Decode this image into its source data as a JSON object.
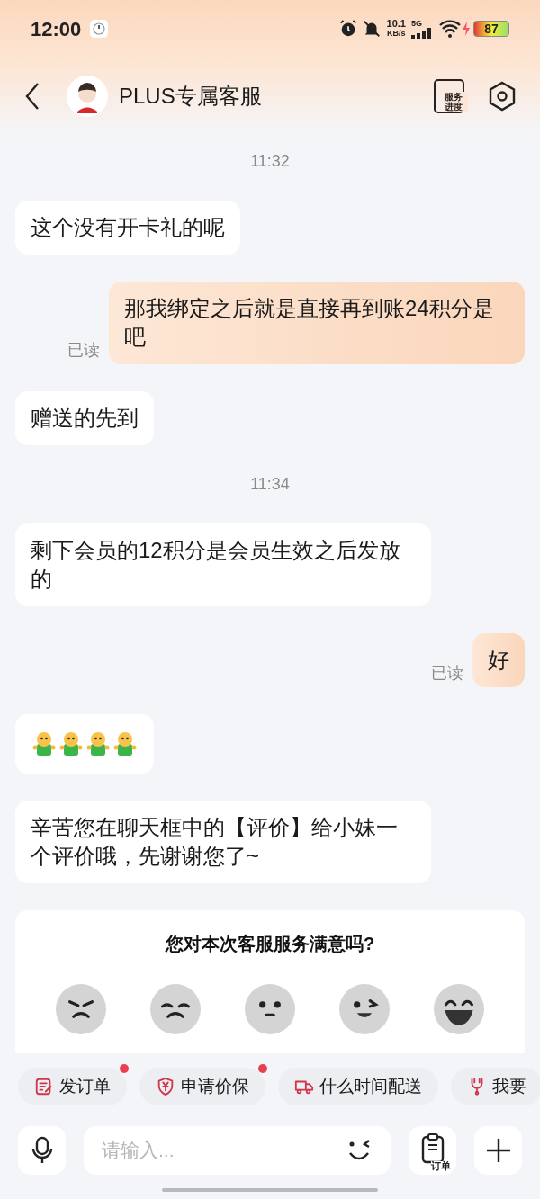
{
  "status_bar": {
    "time": "12:00",
    "net_speed": "10.1",
    "net_unit": "KB/s",
    "network": "5G",
    "battery": "87"
  },
  "header": {
    "title": "PLUS专属客服",
    "progress_label": "服务进度"
  },
  "messages": [
    {
      "kind": "time",
      "text": "11:32"
    },
    {
      "kind": "incoming",
      "text": "这个没有开卡礼的呢"
    },
    {
      "kind": "outgoing",
      "text": "那我绑定之后就是直接再到账24积分是吧",
      "status": "已读"
    },
    {
      "kind": "incoming",
      "text": "赠送的先到"
    },
    {
      "kind": "time",
      "text": "11:34"
    },
    {
      "kind": "incoming",
      "text": "剩下会员的12积分是会员生效之后发放的"
    },
    {
      "kind": "outgoing",
      "text": "好",
      "status": "已读"
    },
    {
      "kind": "stickers",
      "items": [
        {
          "kind": "figure"
        },
        {
          "kind": "figure"
        },
        {
          "kind": "figure"
        },
        {
          "kind": "figure"
        }
      ]
    },
    {
      "kind": "incoming",
      "text": "辛苦您在聊天框中的【评价】给小妹一个评价哦，先谢谢您了~"
    },
    {
      "kind": "rating",
      "question": "您对本次客服服务满意吗?",
      "faces": [
        {
          "kind": "angry"
        },
        {
          "kind": "sad"
        },
        {
          "kind": "neutral"
        },
        {
          "kind": "wink"
        },
        {
          "kind": "laugh"
        }
      ]
    }
  ],
  "quick_actions": [
    {
      "kind": "edit",
      "label": "发订单",
      "badge": true
    },
    {
      "kind": "shield",
      "label": "申请价保",
      "badge": true
    },
    {
      "kind": "truck",
      "label": "什么时间配送",
      "badge": false
    },
    {
      "kind": "tool",
      "label": "我要",
      "badge": false
    }
  ],
  "input": {
    "placeholder": "请输入...",
    "order_label": "订单"
  }
}
